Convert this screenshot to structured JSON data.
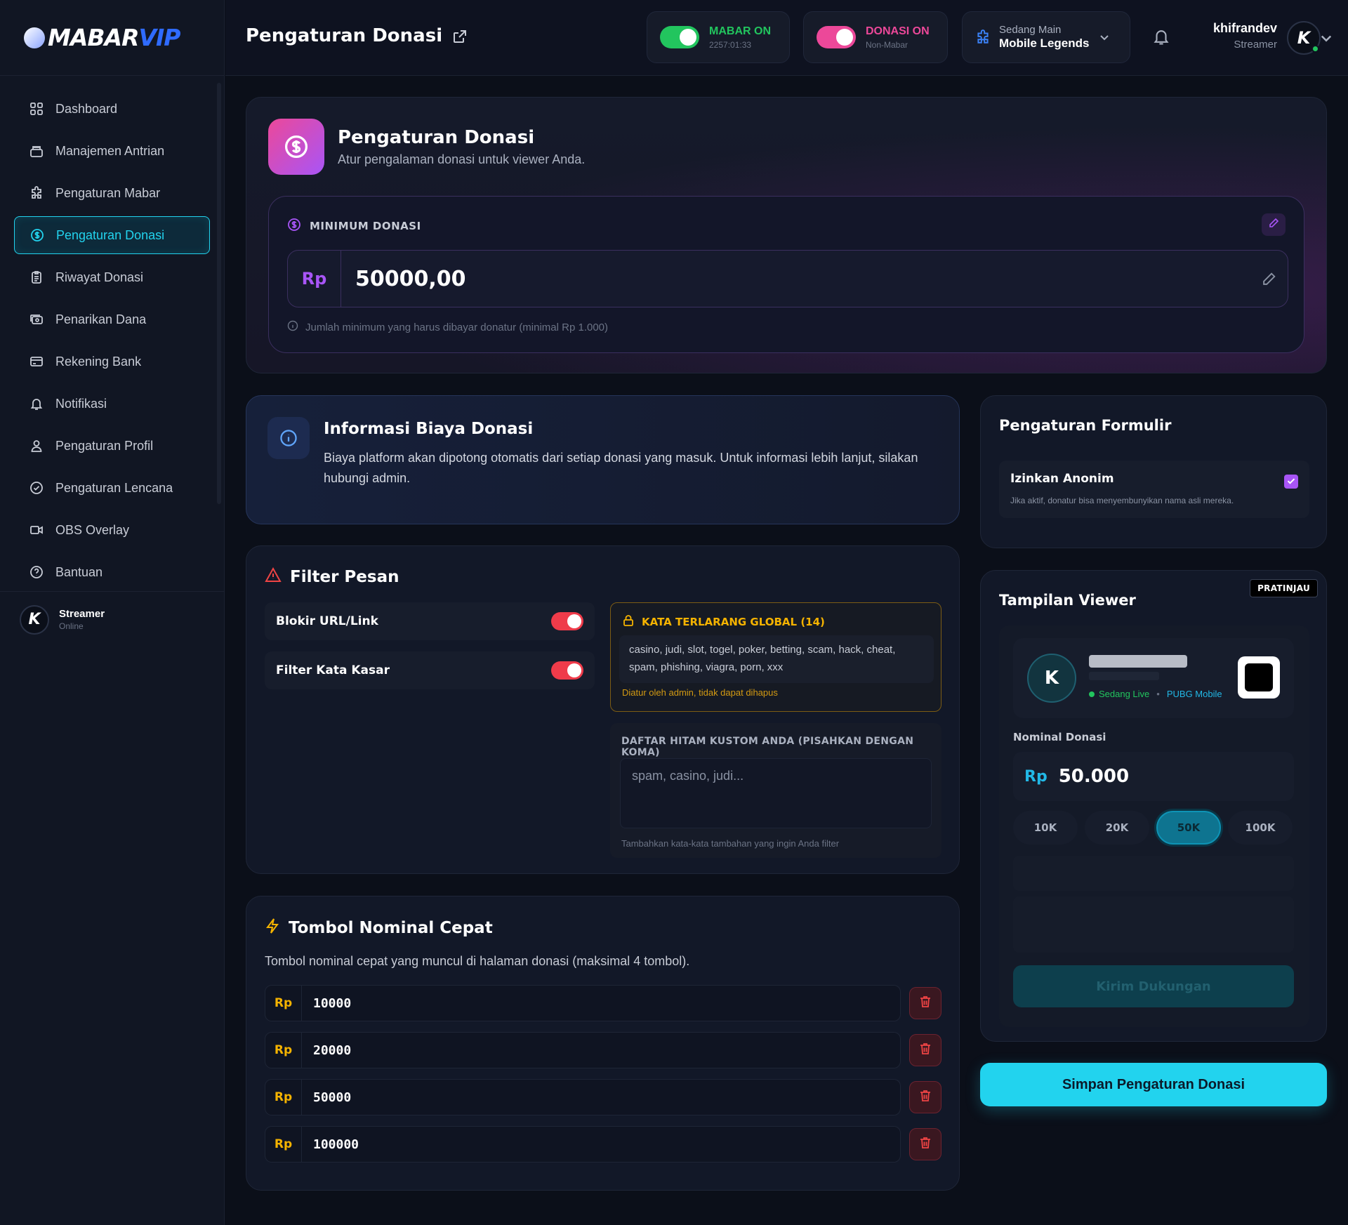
{
  "brand": {
    "name_a": "MABAR",
    "name_b": "VIP"
  },
  "sidebar": {
    "items": [
      {
        "label": "Dashboard",
        "icon": "grid-icon"
      },
      {
        "label": "Manajemen Antrian",
        "icon": "inbox-icon"
      },
      {
        "label": "Pengaturan Mabar",
        "icon": "puzzle-icon"
      },
      {
        "label": "Pengaturan Donasi",
        "icon": "dollar-circle-icon",
        "active": true
      },
      {
        "label": "Riwayat Donasi",
        "icon": "clipboard-icon"
      },
      {
        "label": "Penarikan Dana",
        "icon": "cash-icon"
      },
      {
        "label": "Rekening Bank",
        "icon": "card-icon"
      },
      {
        "label": "Notifikasi",
        "icon": "bell-icon"
      },
      {
        "label": "Pengaturan Profil",
        "icon": "user-icon"
      },
      {
        "label": "Pengaturan Lencana",
        "icon": "badge-check-icon"
      },
      {
        "label": "OBS Overlay",
        "icon": "video-icon"
      },
      {
        "label": "Bantuan",
        "icon": "help-icon"
      }
    ],
    "user": {
      "initial": "K",
      "name": "Streamer",
      "status": "Online"
    }
  },
  "header": {
    "title": "Pengaturan Donasi",
    "mabar": {
      "label": "MABAR ON",
      "sub": "2257:01:33",
      "color": "#22c55e",
      "on": true
    },
    "donasi": {
      "label": "DONASI ON",
      "sub": "Non-Mabar",
      "color": "#ec4899",
      "on": true
    },
    "game": {
      "label": "Sedang Main",
      "value": "Mobile Legends"
    },
    "user": {
      "name": "khifrandev",
      "role": "Streamer",
      "initial": "K"
    }
  },
  "hero": {
    "title": "Pengaturan Donasi",
    "subtitle": "Atur pengalaman donasi untuk viewer Anda.",
    "min_label": "MINIMUM DONASI",
    "currency": "Rp",
    "min_value": "50000,00",
    "hint": "Jumlah minimum yang harus dibayar donatur (minimal Rp 1.000)"
  },
  "info": {
    "title": "Informasi Biaya Donasi",
    "text": "Biaya platform akan dipotong otomatis dari setiap donasi yang masuk. Untuk informasi lebih lanjut, silakan hubungi admin."
  },
  "filter": {
    "title": "Filter Pesan",
    "options": [
      {
        "label": "Blokir URL/Link",
        "on": true
      },
      {
        "label": "Filter Kata Kasar",
        "on": true
      }
    ],
    "banned_title": "KATA TERLARANG GLOBAL (14)",
    "banned_words": "casino, judi, slot, togel, poker, betting, scam, hack, cheat, spam, phishing, viagra, porn, xxx",
    "banned_note": "Diatur oleh admin, tidak dapat dihapus",
    "custom_title": "DAFTAR HITAM KUSTOM ANDA (PISAHKAN DENGAN KOMA)",
    "custom_placeholder": "spam, casino, judi...",
    "custom_note": "Tambahkan kata-kata tambahan yang ingin Anda filter"
  },
  "quick": {
    "title": "Tombol Nominal Cepat",
    "subtitle": "Tombol nominal cepat yang muncul di halaman donasi (maksimal 4 tombol).",
    "currency": "Rp",
    "values": [
      "10000",
      "20000",
      "50000",
      "100000"
    ]
  },
  "form": {
    "title": "Pengaturan Formulir",
    "anon_label": "Izinkan Anonim",
    "anon_desc": "Jika aktif, donatur bisa menyembunyikan nama asli mereka.",
    "anon_checked": true
  },
  "viewer": {
    "title": "Tampilan Viewer",
    "badge": "PRATINJAU",
    "initial": "K",
    "live": "Sedang Live",
    "game": "PUBG Mobile",
    "amount_label": "Nominal Donasi",
    "currency": "Rp",
    "amount": "50.000",
    "chips": [
      "10K",
      "20K",
      "50K",
      "100K"
    ],
    "active_chip": "50K",
    "send": "Kirim Dukungan"
  },
  "save_label": "Simpan Pengaturan Donasi"
}
